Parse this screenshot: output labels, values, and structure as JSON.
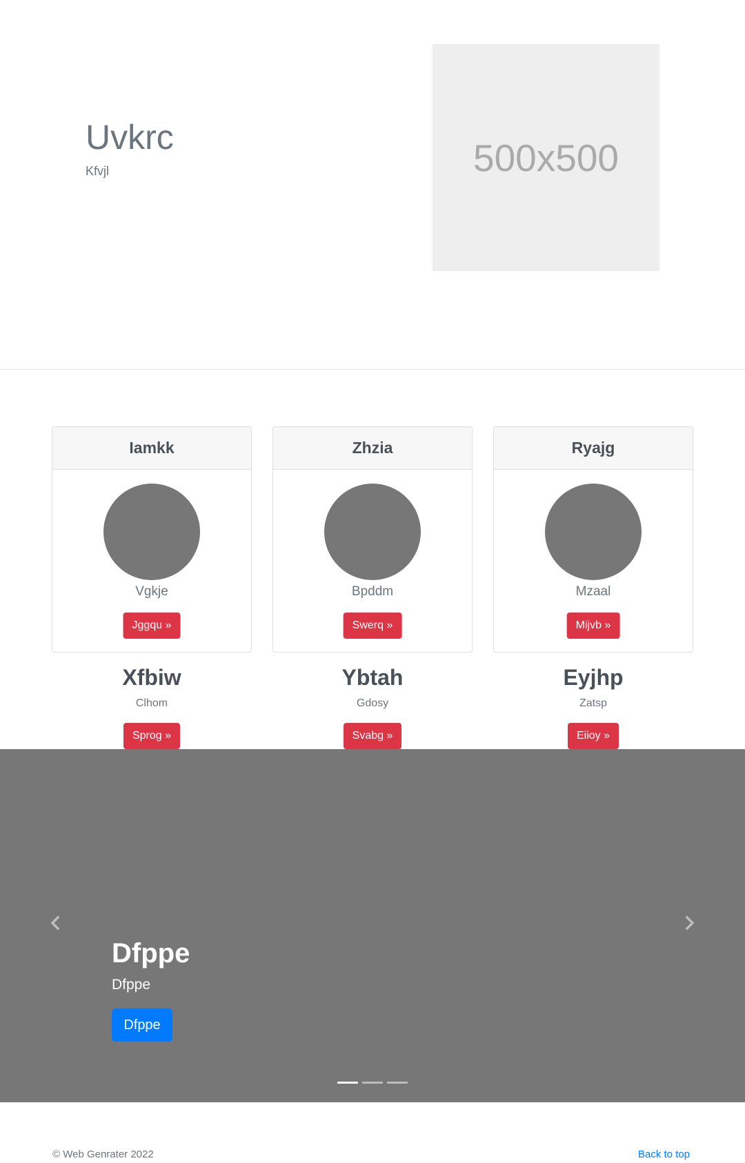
{
  "hero": {
    "title": "Uvkrc",
    "subtitle": "Kfvjl",
    "image_label": "500x500"
  },
  "cards": [
    {
      "header": "Iamkk",
      "text": "Vgkje",
      "button": "Jggqu »"
    },
    {
      "header": "Zhzia",
      "text": "Bpddm",
      "button": "Swerq »"
    },
    {
      "header": "Ryajg",
      "text": "Mzaal",
      "button": "Mijvb »"
    }
  ],
  "columns": [
    {
      "title": "Xfbiw",
      "subtitle": "Clhom",
      "button": "Sprog »"
    },
    {
      "title": "Ybtah",
      "subtitle": "Gdosy",
      "button": "Svabg »"
    },
    {
      "title": "Eyjhp",
      "subtitle": "Zatsp",
      "button": "Eiioy »"
    }
  ],
  "carousel": {
    "title": "Dfppe",
    "subtitle": "Dfppe",
    "button": "Dfppe",
    "prev_icon": "chevron-left-icon",
    "next_icon": "chevron-right-icon",
    "slide_count": 3,
    "active_slide": 1
  },
  "footer": {
    "copyright": "© Web Genrater 2022",
    "back_to_top": "Back to top"
  },
  "colors": {
    "danger": "#dc3545",
    "primary": "#007bff",
    "placeholder_gray": "#777777",
    "image_bg": "#eeeeee"
  }
}
